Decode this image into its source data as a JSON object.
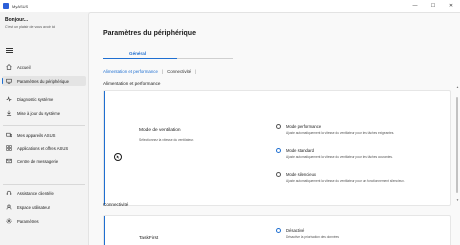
{
  "window": {
    "title": "MyASUS",
    "controls": [
      "—",
      "☐",
      "✕"
    ]
  },
  "profile": {
    "name": "Bonjour...",
    "subtitle": "C'est un plaisir de vous avoir ici"
  },
  "sidebar": {
    "items": [
      {
        "label": "Accueil",
        "icon": "home-icon"
      },
      {
        "label": "Paramètres du périphérique",
        "icon": "device-settings-icon"
      },
      {
        "label": "Diagnostic système",
        "icon": "diagnostic-icon"
      },
      {
        "label": "Mise à jour du système",
        "icon": "update-icon"
      },
      {
        "label": "Mes appareils ASUS",
        "icon": "devices-icon"
      },
      {
        "label": "Applications et offres ASUS",
        "icon": "apps-icon"
      },
      {
        "label": "Centre de messagerie",
        "icon": "message-icon"
      },
      {
        "label": "Assistance clientèle",
        "icon": "support-icon"
      },
      {
        "label": "Espace utilisateur",
        "icon": "user-icon"
      },
      {
        "label": "Paramètres",
        "icon": "gear-icon"
      }
    ]
  },
  "main": {
    "title": "Paramètres du périphérique",
    "tab": "Général",
    "subnav": {
      "active": "Alimentation et performance",
      "separator": "|",
      "other": "Connectivité",
      "trailing": "|"
    },
    "section1": "Alimentation et performance",
    "fan": {
      "title": "Mode de ventilation",
      "subtitle": "Sélectionnez la vitesse du ventilateur.",
      "options": [
        {
          "label": "Mode performance",
          "desc": "Ajuste automatiquement la vitesse du ventilateur pour les tâches exigeantes.",
          "checked": false
        },
        {
          "label": "Mode standard",
          "desc": "Ajuste automatiquement la vitesse du ventilateur pour les tâches courantes.",
          "checked": true
        },
        {
          "label": "Mode silencieux",
          "desc": "Ajuste automatiquement la vitesse du ventilateur pour un fonctionnement silencieux.",
          "checked": false
        }
      ]
    },
    "section2": "Connectivité",
    "taskfirst": {
      "title": "TaskFirst",
      "option_label": "Désactivé",
      "option_desc": "Désactive la priorisation des données"
    }
  },
  "colors": {
    "accent": "#1f6fd1",
    "sidebar_bg": "#f3f3f3",
    "content_bg": "#f9f9f9"
  }
}
